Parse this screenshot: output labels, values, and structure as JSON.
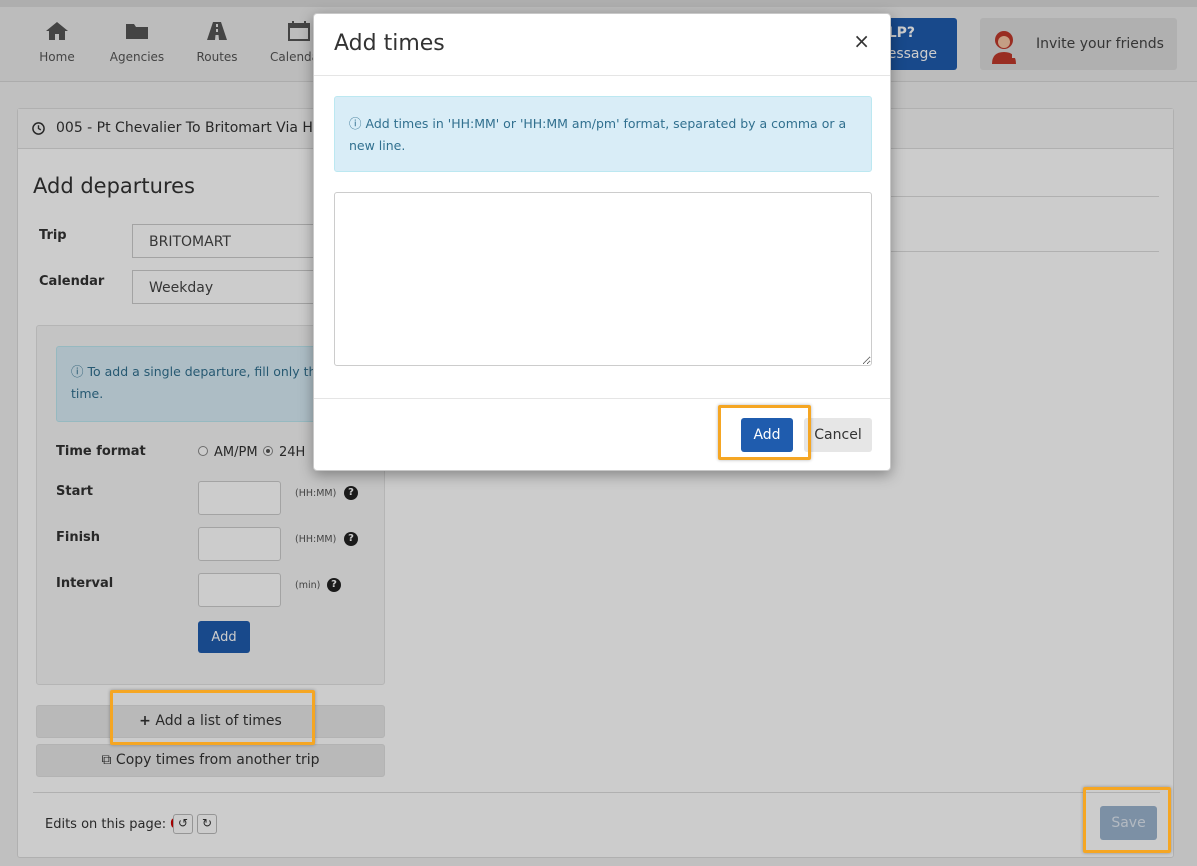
{
  "nav": {
    "items": [
      {
        "label": "Home",
        "icon": "home-icon"
      },
      {
        "label": "Agencies",
        "icon": "folder-icon"
      },
      {
        "label": "Routes",
        "icon": "road-icon"
      },
      {
        "label": "Calenda",
        "icon": "calendar-icon"
      }
    ],
    "help": {
      "line1": "LP?",
      "line2": "essage"
    },
    "invite_label": "Invite your friends"
  },
  "page": {
    "route_title": "005 - Pt Chevalier To Britomart Via He",
    "section_title": "Add departures",
    "trip_label": "Trip",
    "trip_value": "BRITOMART",
    "calendar_label": "Calendar",
    "calendar_value": "Weekday",
    "info_text": "To add a single departure, fill only the time.",
    "time_format_label": "Time format",
    "ampm_label": "AM/PM",
    "h24_label": "24H",
    "start_label": "Start",
    "finish_label": "Finish",
    "interval_label": "Interval",
    "hhmm_hint": "(HH:MM)",
    "min_hint": "(min)",
    "add_label": "Add",
    "add_list_label": "Add a list of times",
    "copy_label": "Copy times from another trip",
    "edits_label": "Edits on this page:",
    "edits_count": "0",
    "save_label": "Save"
  },
  "modal": {
    "title": "Add times",
    "close": "×",
    "info": "Add times in 'HH:MM' or 'HH:MM am/pm' format, separated by a comma or a new line.",
    "textarea_value": "",
    "add_label": "Add",
    "cancel_label": "Cancel"
  },
  "colors": {
    "primary": "#1f5cae",
    "highlight": "#f5a623",
    "info_bg": "#d9edf7",
    "edits_count": "#cc0000"
  }
}
